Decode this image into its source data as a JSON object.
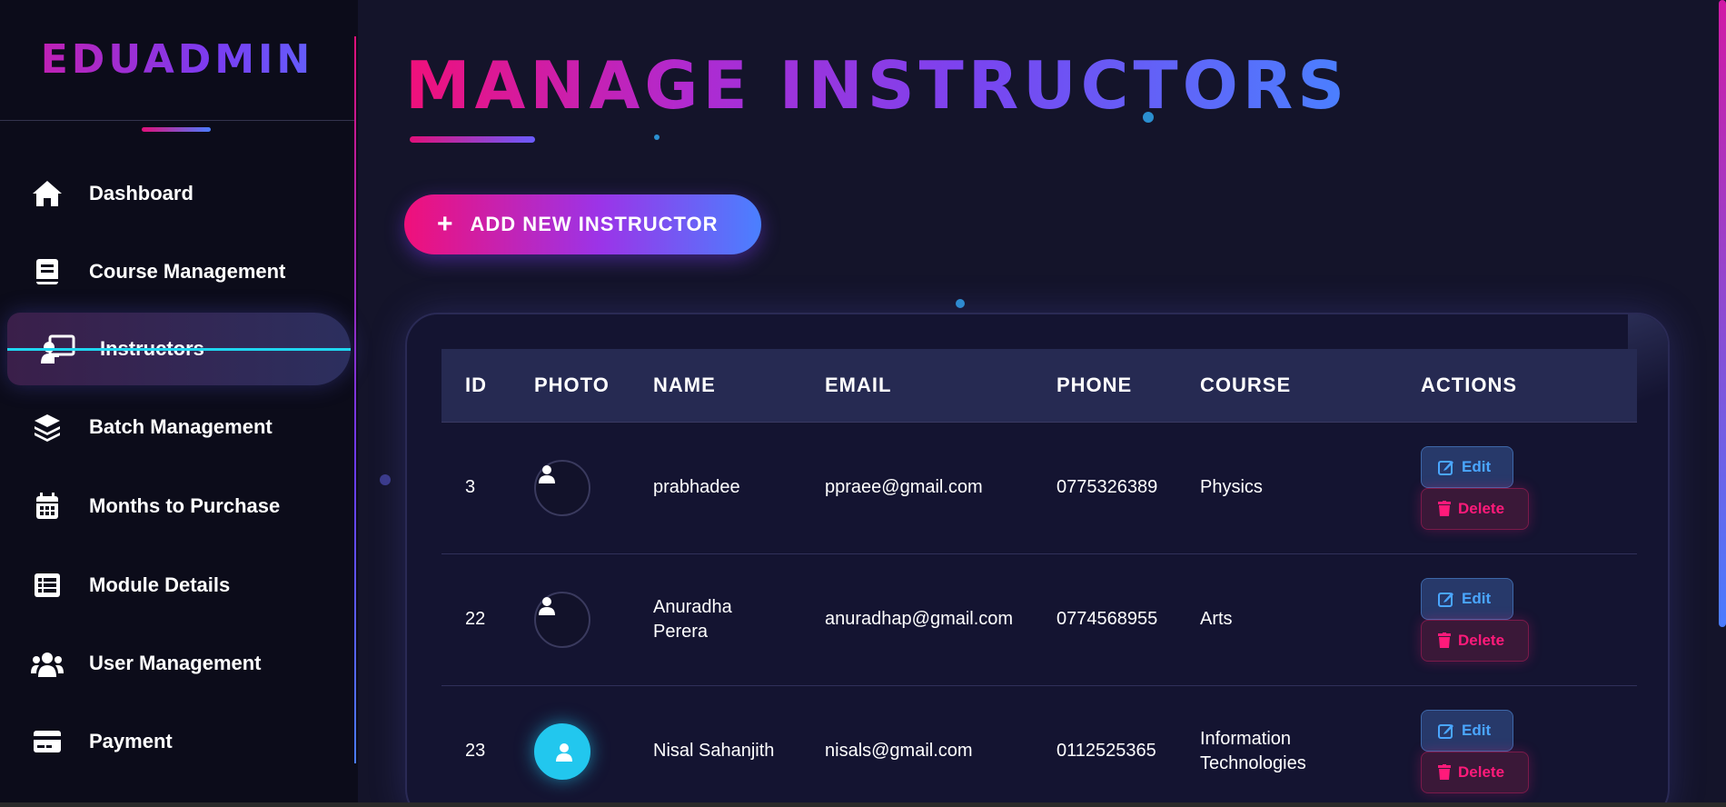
{
  "sidebar": {
    "brand": "EDUADMIN",
    "items": [
      {
        "label": "Dashboard",
        "icon": "home-icon"
      },
      {
        "label": "Course Management",
        "icon": "book-icon"
      },
      {
        "label": "Instructors",
        "icon": "chalkboard-teacher-icon",
        "active": true
      },
      {
        "label": "Batch Management",
        "icon": "layers-icon"
      },
      {
        "label": "Months to Purchase",
        "icon": "calendar-icon"
      },
      {
        "label": "Module Details",
        "icon": "list-icon"
      },
      {
        "label": "User Management",
        "icon": "users-icon"
      },
      {
        "label": "Payment",
        "icon": "credit-card-icon"
      }
    ]
  },
  "main": {
    "title": "MANAGE INSTRUCTORS",
    "add_button": "ADD NEW INSTRUCTOR",
    "table": {
      "headers": [
        "ID",
        "PHOTO",
        "NAME",
        "EMAIL",
        "PHONE",
        "COURSE",
        "ACTIONS"
      ],
      "rows": [
        {
          "id": "3",
          "name": "prabhadee",
          "email": "ppraee@gmail.com",
          "phone": "0775326389",
          "course": "Physics",
          "photo": "placeholder"
        },
        {
          "id": "22",
          "name": "Anuradha Perera",
          "email": "anuradhap@gmail.com",
          "phone": "0774568955",
          "course": "Arts",
          "photo": "placeholder"
        },
        {
          "id": "23",
          "name": "Nisal Sahanjith",
          "email": "nisals@gmail.com",
          "phone": "0112525365",
          "course": "Information Technologies",
          "photo": "avatar"
        }
      ],
      "edit_label": "Edit",
      "delete_label": "Delete"
    }
  },
  "colors": {
    "background": "#14142a",
    "sidebar": "#0c0c1a",
    "accent_pink": "#f0107a",
    "accent_blue": "#4a80ff",
    "edit": "#4aa6ff",
    "delete": "#ff1a7a"
  }
}
